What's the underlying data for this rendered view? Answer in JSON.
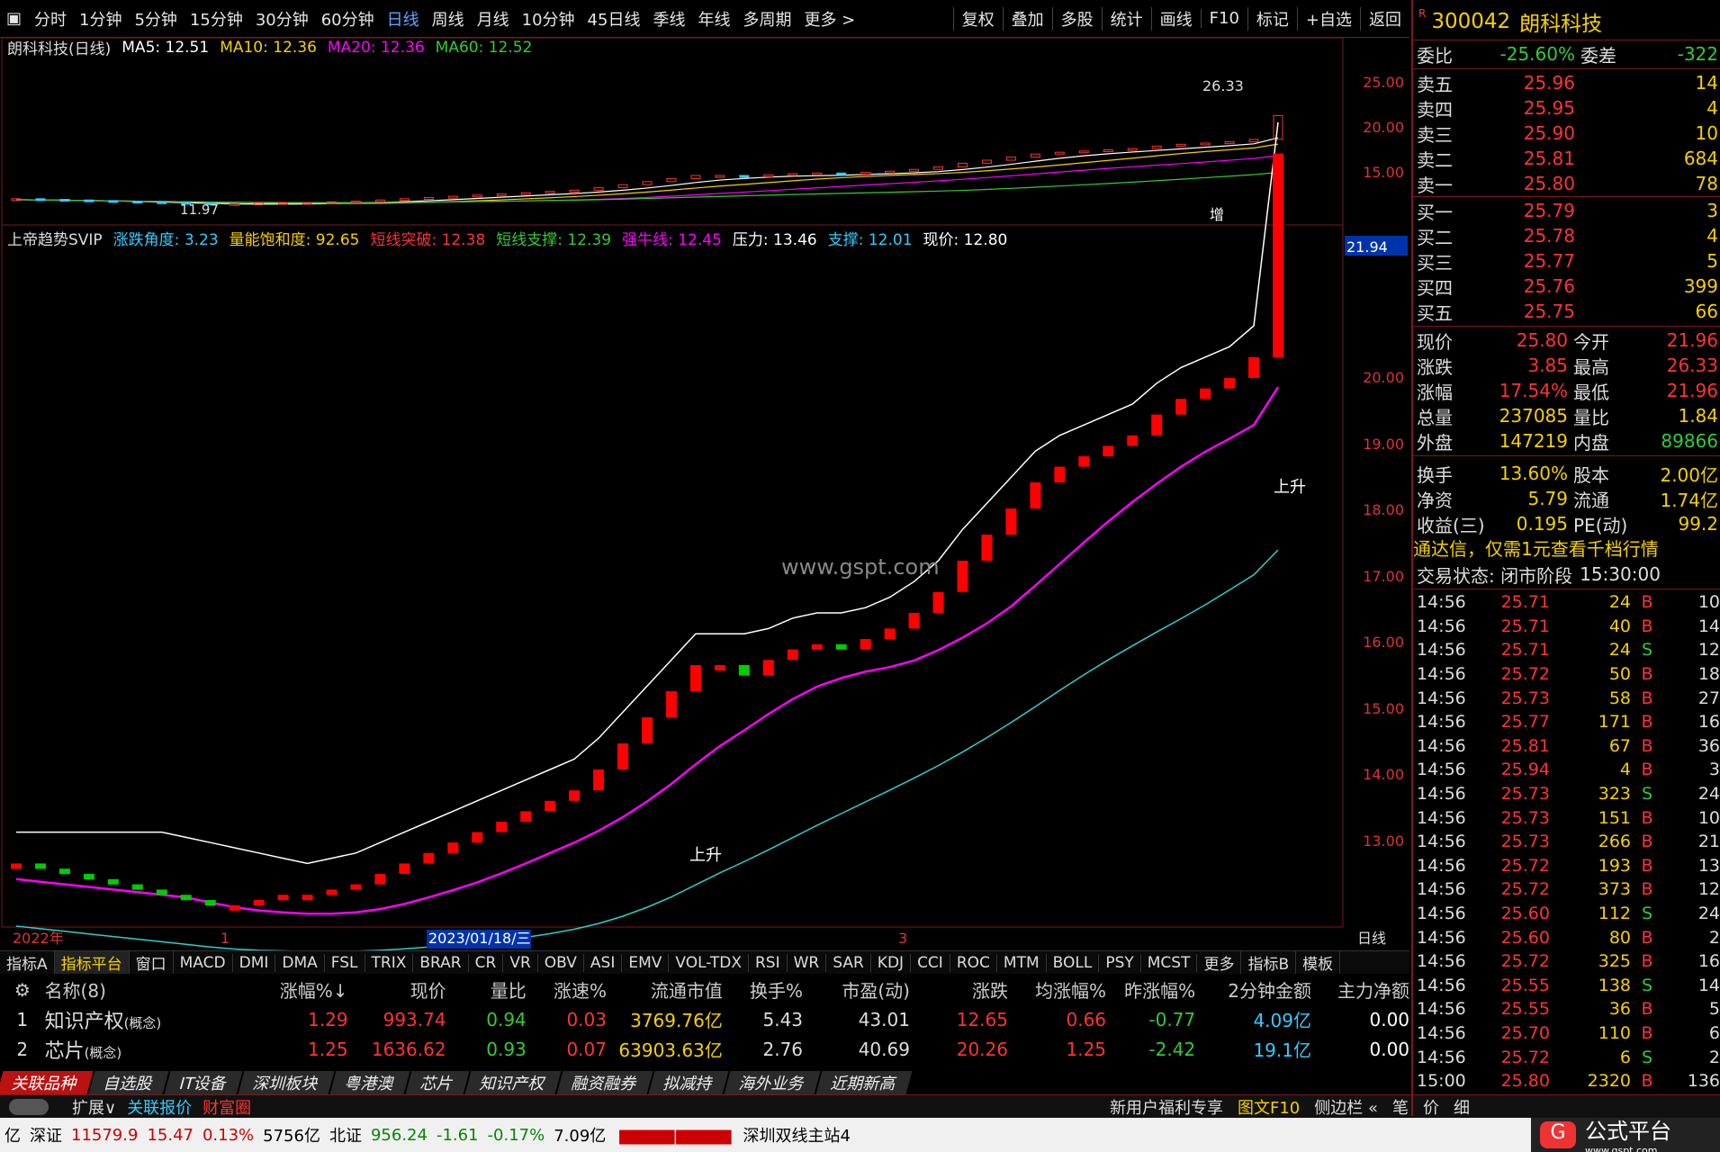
{
  "toolbar": {
    "periods": [
      "分时",
      "1分钟",
      "5分钟",
      "15分钟",
      "30分钟",
      "60分钟",
      "日线",
      "周线",
      "月线",
      "10分钟",
      "45日线",
      "季线",
      "年线",
      "多周期",
      "更多 >"
    ],
    "active": "日线",
    "right": [
      "复权",
      "叠加",
      "多股",
      "统计",
      "画线",
      "F10",
      "标记",
      "+自选",
      "返回"
    ]
  },
  "main": {
    "title": "朗科科技(日线)",
    "ma5": "MA5: 12.51",
    "ma10": "MA10: 12.36",
    "ma20": "MA20: 12.36",
    "ma60": "MA60: 12.52",
    "high_label": "26.33",
    "low_label": "11.97",
    "zeng": "增",
    "axis": [
      "25.00",
      "20.00",
      "15.00"
    ]
  },
  "indicator": {
    "name": "上帝趋势SVIP",
    "angle": "涨跌角度: 3.23",
    "energy": "量能饱和度: 92.65",
    "break": "短线突破: 12.38",
    "support": "短线支撑: 12.39",
    "bull": "强牛线: 12.45",
    "pressure": "压力: 13.46",
    "sup2": "支撑: 12.01",
    "price": "现价: 12.80",
    "cur": "21.94",
    "up1": "上升",
    "up2": "上升",
    "watermark": "www.gspt.com",
    "axis": [
      "20.00",
      "19.00",
      "18.00",
      "17.00",
      "16.00",
      "15.00",
      "14.00",
      "13.00"
    ]
  },
  "dates": {
    "year": "2022年",
    "m1": "1",
    "sel": "2023/01/18/三",
    "m3": "3",
    "mode": "日线"
  },
  "indtabs": [
    "指标A",
    "指标平台",
    "窗口",
    "MACD",
    "DMI",
    "DMA",
    "FSL",
    "TRIX",
    "BRAR",
    "CR",
    "VR",
    "OBV",
    "ASI",
    "EMV",
    "VOL-TDX",
    "RSI",
    "WR",
    "SAR",
    "KDJ",
    "CCI",
    "ROC",
    "MTM",
    "BOLL",
    "PSY",
    "MCST",
    "更多",
    "指标B",
    "模板"
  ],
  "table": {
    "headers": [
      "名称(8)",
      "涨幅%↓",
      "现价",
      "量比",
      "涨速%",
      "流通市值",
      "换手%",
      "市盈(动)",
      "涨跌",
      "均涨幅%",
      "昨涨幅%",
      "2分钟金额",
      "主力净额"
    ],
    "rows": [
      {
        "i": "1",
        "name": "知识产权",
        "tag": "(概念)",
        "v": [
          "1.29",
          "993.74",
          "0.94",
          "0.03",
          "3769.76亿",
          "5.43",
          "43.01",
          "12.65",
          "0.66",
          "-0.77",
          "4.09亿",
          "0.00"
        ]
      },
      {
        "i": "2",
        "name": "芯片",
        "tag": "(概念)",
        "v": [
          "1.25",
          "1636.62",
          "0.93",
          "0.07",
          "63903.63亿",
          "2.76",
          "40.69",
          "20.26",
          "1.25",
          "-2.42",
          "19.1亿",
          "0.00"
        ]
      }
    ]
  },
  "tabs": [
    "关联品种",
    "自选股",
    "IT设备",
    "深圳板块",
    "粤港澳",
    "芯片",
    "知识产权",
    "融资融券",
    "拟减持",
    "海外业务",
    "近期新高"
  ],
  "statusbar": {
    "left": [
      "扩展∨",
      "关联报价",
      "财富圈"
    ],
    "right": [
      "新用户福利专享",
      "图文F10",
      "侧边栏 «",
      "笔",
      "价",
      "细"
    ]
  },
  "bottom": [
    "亿",
    "深证",
    "11579.9",
    "15.47",
    "0.13%",
    "5756亿",
    "北证",
    "956.24",
    "-1.61",
    "-0.17%",
    "7.09亿",
    "深圳双线主站4"
  ],
  "logo": {
    "name": "公式平台",
    "url": "www.gspt.com"
  },
  "quote": {
    "code": "300042",
    "name": "朗科科技",
    "wb": "委比",
    "wbv": "-25.60%",
    "wc": "委差",
    "wcv": "-322",
    "asks": [
      [
        "卖五",
        "25.96",
        "14"
      ],
      [
        "卖四",
        "25.95",
        "4"
      ],
      [
        "卖三",
        "25.90",
        "10"
      ],
      [
        "卖二",
        "25.81",
        "684"
      ],
      [
        "卖一",
        "25.80",
        "78"
      ]
    ],
    "bids": [
      [
        "买一",
        "25.79",
        "3"
      ],
      [
        "买二",
        "25.78",
        "4"
      ],
      [
        "买三",
        "25.77",
        "5"
      ],
      [
        "买四",
        "25.76",
        "399"
      ],
      [
        "买五",
        "25.75",
        "66"
      ]
    ],
    "stats": [
      [
        "现价",
        "25.80",
        "今开",
        "21.96"
      ],
      [
        "涨跌",
        "3.85",
        "最高",
        "26.33"
      ],
      [
        "涨幅",
        "17.54%",
        "最低",
        "21.96"
      ],
      [
        "总量",
        "237085",
        "量比",
        "1.84"
      ],
      [
        "外盘",
        "147219",
        "内盘",
        "89866"
      ],
      [
        "换手",
        "13.60%",
        "股本",
        "2.00亿"
      ],
      [
        "净资",
        "5.79",
        "流通",
        "1.74亿"
      ],
      [
        "收益(三)",
        "0.195",
        "PE(动)",
        "99.2"
      ]
    ],
    "promo": "通达信，仅需1元查看千档行情",
    "state": "交易状态: 闭市阶段",
    "time": "15:30:00",
    "ticks": [
      [
        "14:56",
        "25.71",
        "24",
        "B",
        "10"
      ],
      [
        "14:56",
        "25.71",
        "40",
        "B",
        "14"
      ],
      [
        "14:56",
        "25.71",
        "24",
        "S",
        "12"
      ],
      [
        "14:56",
        "25.72",
        "50",
        "B",
        "18"
      ],
      [
        "14:56",
        "25.73",
        "58",
        "B",
        "27"
      ],
      [
        "14:56",
        "25.77",
        "171",
        "B",
        "16"
      ],
      [
        "14:56",
        "25.81",
        "67",
        "B",
        "36"
      ],
      [
        "14:56",
        "25.94",
        "4",
        "B",
        "3"
      ],
      [
        "14:56",
        "25.73",
        "323",
        "S",
        "24"
      ],
      [
        "14:56",
        "25.73",
        "151",
        "B",
        "10"
      ],
      [
        "14:56",
        "25.73",
        "266",
        "B",
        "21"
      ],
      [
        "14:56",
        "25.72",
        "193",
        "B",
        "13"
      ],
      [
        "14:56",
        "25.72",
        "373",
        "B",
        "12"
      ],
      [
        "14:56",
        "25.60",
        "112",
        "S",
        "24"
      ],
      [
        "14:56",
        "25.60",
        "80",
        "B",
        "2"
      ],
      [
        "14:56",
        "25.72",
        "325",
        "B",
        "16"
      ],
      [
        "14:56",
        "25.55",
        "138",
        "S",
        "14"
      ],
      [
        "14:56",
        "25.55",
        "36",
        "B",
        "5"
      ],
      [
        "14:56",
        "25.70",
        "110",
        "B",
        "6"
      ],
      [
        "14:56",
        "25.72",
        "6",
        "S",
        "2"
      ],
      [
        "15:00",
        "25.80",
        "2320",
        "B",
        "136"
      ]
    ]
  },
  "chart_data": {
    "type": "line",
    "closes": [
      12.2,
      12.1,
      12.0,
      11.9,
      11.8,
      11.7,
      11.6,
      11.5,
      11.4,
      11.4,
      11.5,
      11.6,
      11.6,
      11.7,
      11.8,
      12.0,
      12.2,
      12.4,
      12.6,
      12.8,
      13.0,
      13.2,
      13.4,
      13.6,
      14.0,
      14.5,
      15.0,
      15.5,
      16.0,
      16.0,
      15.8,
      16.1,
      16.3,
      16.4,
      16.3,
      16.5,
      16.7,
      17.0,
      17.4,
      18.0,
      18.5,
      19.0,
      19.5,
      19.8,
      20.0,
      20.2,
      20.4,
      20.8,
      21.1,
      21.3,
      21.5,
      21.9,
      25.8
    ]
  }
}
